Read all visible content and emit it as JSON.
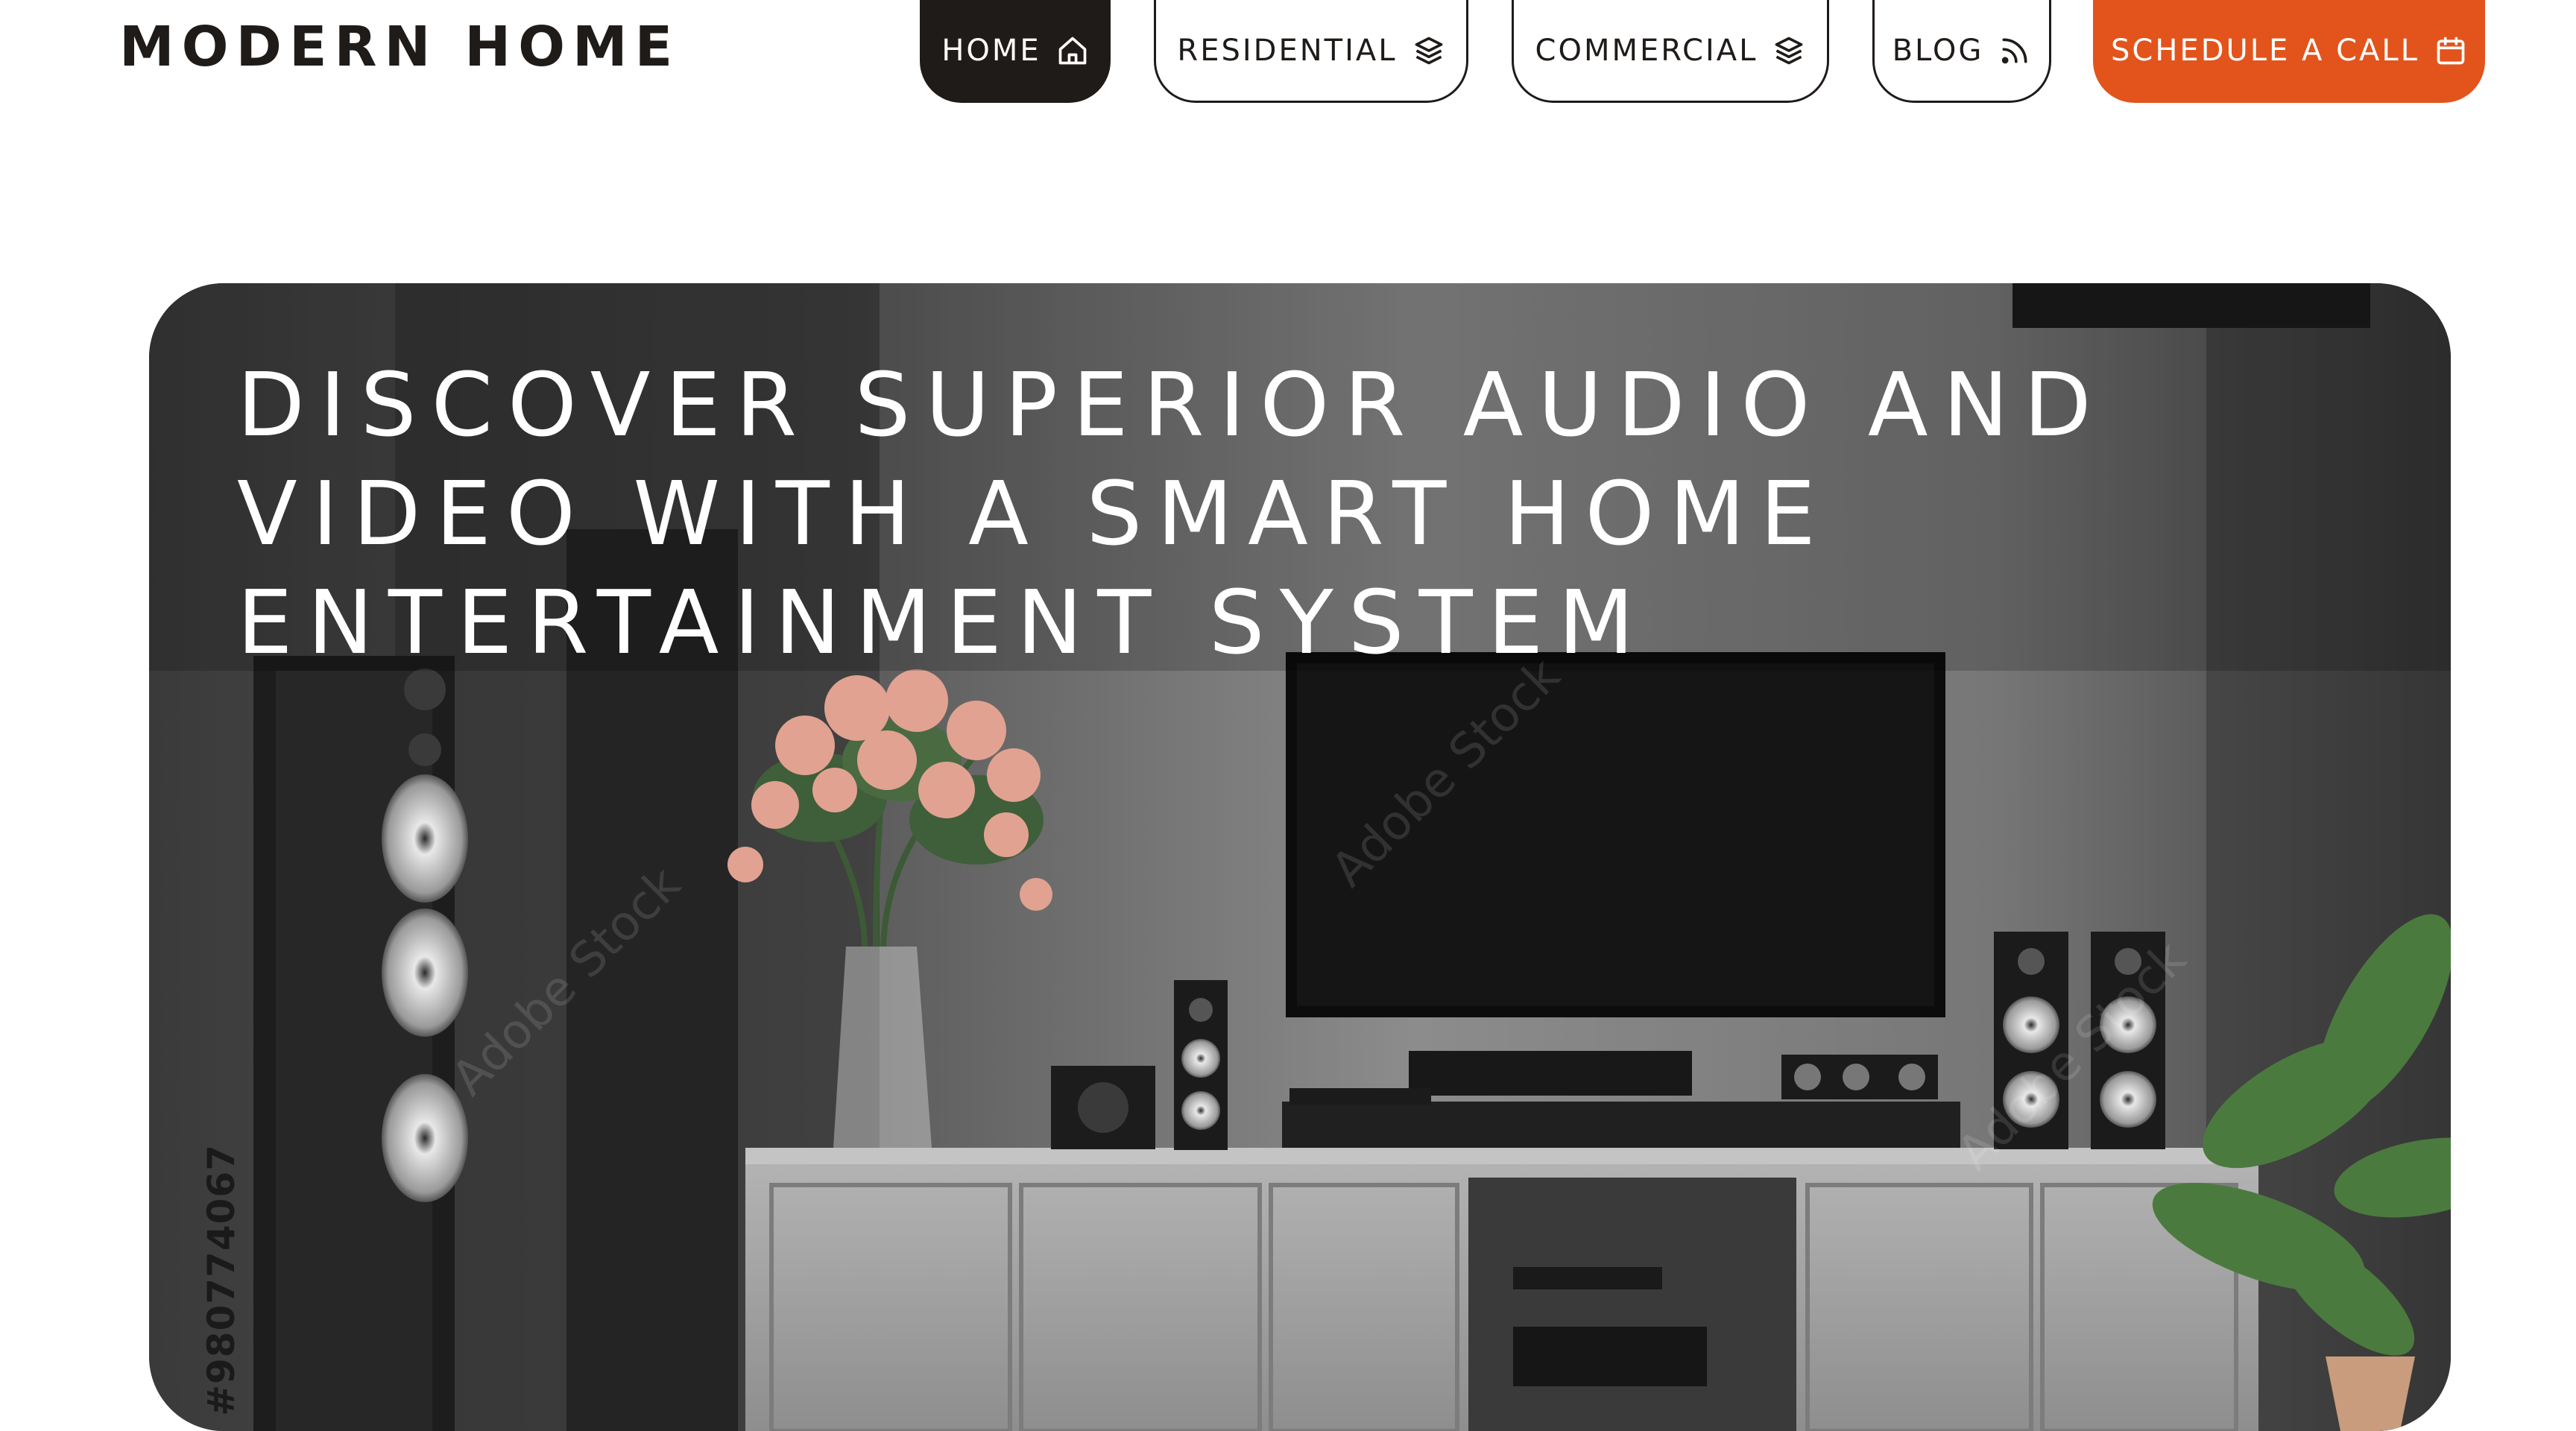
{
  "brand": {
    "logo": "MODERN HOME"
  },
  "nav": {
    "home": "HOME",
    "residential": "RESIDENTIAL",
    "commercial": "COMMERCIAL",
    "blog": "BLOG",
    "schedule": "SCHEDULE A CALL"
  },
  "hero": {
    "title": "DISCOVER SUPERIOR AUDIO AND VIDEO WITH A SMART HOME ENTERTAINMENT SYSTEM",
    "stock_id": "#980774067",
    "watermark": "Adobe Stock"
  },
  "colors": {
    "accent": "#e2541c",
    "dark": "#1f1b19",
    "background": "#ffffff"
  },
  "icons": {
    "home": "home-icon",
    "residential": "layers-icon",
    "commercial": "layers-icon",
    "blog": "rss-icon",
    "schedule": "calendar-icon"
  }
}
